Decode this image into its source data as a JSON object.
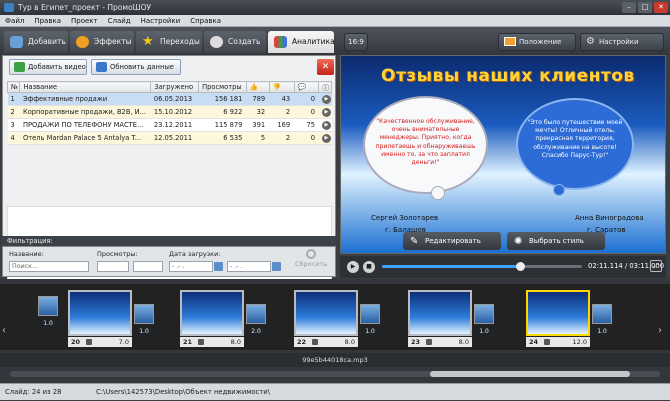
{
  "window": {
    "title": "Тур в Египет_проект - ПромоШОУ",
    "minimize": "–",
    "maximize": "□",
    "close": "✕"
  },
  "menu": [
    "Файл",
    "Правка",
    "Проект",
    "Слайд",
    "Настройки",
    "Справка"
  ],
  "tabs": [
    {
      "label": "Добавить",
      "icon": "add-folder-icon",
      "color": "#6aa0d8"
    },
    {
      "label": "Эффекты",
      "icon": "effects-icon",
      "color": "#f0a020"
    },
    {
      "label": "Переходы",
      "icon": "star-icon",
      "color": "#f5c518"
    },
    {
      "label": "Создать",
      "icon": "film-reel-icon",
      "color": "#dddddd"
    },
    {
      "label": "Аналитика",
      "icon": "chart-icon",
      "color": "#e04040"
    }
  ],
  "toolbar_right": {
    "aspect": "16:9",
    "photo_position": "Положение фото",
    "project_settings": "Настройки проекта"
  },
  "analytics": {
    "add_video": "Добавить видео",
    "refresh_data": "Обновить данные",
    "delete_icon": "✕",
    "columns": [
      "№",
      "Название",
      "Загружено",
      "Просмотры",
      "likes-icon",
      "dislikes-icon",
      "comments-icon",
      "info-icon"
    ],
    "rows": [
      {
        "n": "1",
        "title": "Эффективные продажи",
        "date": "06.05.2013",
        "views": "156 181",
        "likes": "789",
        "dislikes": "43",
        "comments": "0"
      },
      {
        "n": "2",
        "title": "Корпоративные продажи, B2B, И...",
        "date": "15.10.2012",
        "views": "6 922",
        "likes": "32",
        "dislikes": "2",
        "comments": "0"
      },
      {
        "n": "3",
        "title": "ПРОДАЖИ ПО ТЕЛЕФОНУ МАСТЕ...",
        "date": "23.12.2011",
        "views": "115 879",
        "likes": "391",
        "dislikes": "169",
        "comments": "75"
      },
      {
        "n": "4",
        "title": "Отель Mardan Palace 5 Antalya T...",
        "date": "12.05.2011",
        "views": "6 535",
        "likes": "5",
        "dislikes": "2",
        "comments": "0"
      }
    ]
  },
  "filter": {
    "header": "Фильтрация:",
    "name_label": "Название:",
    "name_placeholder": "Поиск...",
    "views_label": "Просмотры:",
    "date_label": "Дата загрузки:",
    "date_from": "- .- .",
    "date_to": "- .- .",
    "reset": "Сбросить"
  },
  "slide": {
    "title": "Отзывы наших клиентов",
    "quote1": "\"Качественное обслуживание, очень внимательные менеджеры. Приятно, когда прилетаешь и обнаруживаешь именно то, за что заплатил деньги!\"",
    "quote2": "\"Это было путешествие моей мечты! Отличный отель, прекрасная территория, обслуживание на высоте! Спасибо Парус-Тур!\"",
    "name1a": "Сергей Золотарев",
    "name1b": "г. Балашов",
    "name2a": "Анна Виноградова",
    "name2b": "г. Саратов",
    "edit": "Редактировать",
    "choose_style": "Выбрать стиль"
  },
  "player": {
    "time": "02:11.114 / 03:11.000",
    "progress": 0.69
  },
  "timeline": {
    "lead_duration": "1.0",
    "slots": [
      {
        "n": "20",
        "dur": "7.0",
        "trans": "1.0",
        "selected": false
      },
      {
        "n": "21",
        "dur": "8.0",
        "trans": "2.0",
        "selected": false
      },
      {
        "n": "22",
        "dur": "8.0",
        "trans": "1.0",
        "selected": false
      },
      {
        "n": "23",
        "dur": "8.0",
        "trans": "1.0",
        "selected": false
      },
      {
        "n": "24",
        "dur": "12.0",
        "trans": "1.0",
        "selected": true
      }
    ],
    "audio": "99e5b44018ca.mp3"
  },
  "status": {
    "slide": "Слайд: 24 из 28",
    "path": "C:\\Users\\142573\\Desktop\\Объект недвижимости\\"
  }
}
